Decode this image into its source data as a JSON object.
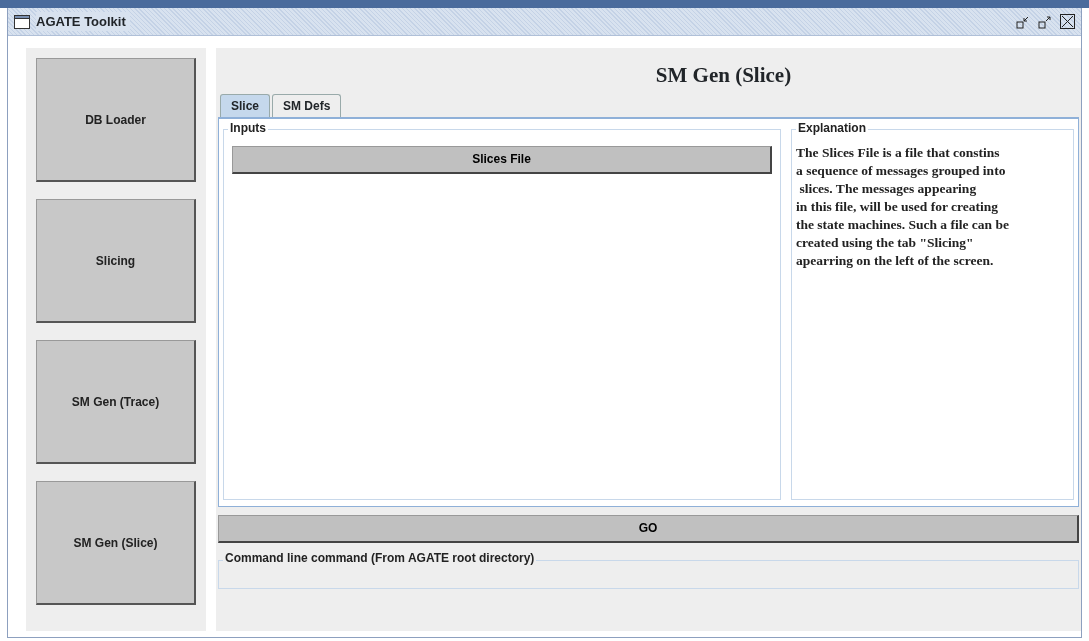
{
  "window": {
    "title": "AGATE Toolkit"
  },
  "sidebar": {
    "items": [
      {
        "label": "DB Loader"
      },
      {
        "label": "Slicing"
      },
      {
        "label": "SM Gen (Trace)"
      },
      {
        "label": "SM Gen (Slice)"
      }
    ]
  },
  "panel": {
    "title": "SM Gen (Slice)",
    "tabs": [
      {
        "label": "Slice",
        "selected": true
      },
      {
        "label": "SM Defs",
        "selected": false
      }
    ],
    "inputs": {
      "legend": "Inputs",
      "button": "Slices File"
    },
    "explanation": {
      "legend": "Explanation",
      "text": "The Slices File is a file that constins\na sequence of messages grouped into\n slices. The messages appearing\nin this file, will be used for creating\nthe state machines. Such a file can be\ncreated using the tab \"Slicing\"\napearring on the left of the screen."
    },
    "go_button": "GO",
    "command": {
      "legend": "Command line command (From AGATE root directory)"
    }
  }
}
